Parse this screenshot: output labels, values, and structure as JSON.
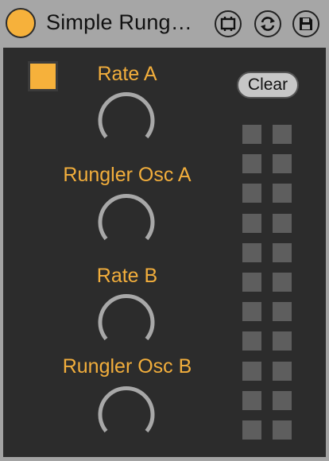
{
  "titlebar": {
    "title": "Simple Rung…",
    "buttons": [
      "freeze-icon",
      "hot-swap-icon",
      "save-icon"
    ]
  },
  "colors": {
    "accent": "#f6b13b",
    "panel": "#2c2c2c",
    "knob_arc": "#a8a8a8",
    "cell": "#5e5e5e"
  },
  "device": {
    "toggle_on": true,
    "clear_label": "Clear",
    "knobs": [
      {
        "label": "Rate A"
      },
      {
        "label": "Rungler Osc A"
      },
      {
        "label": "Rate B"
      },
      {
        "label": "Rungler Osc B"
      }
    ],
    "grid": {
      "columns": 2,
      "rows": 11
    }
  }
}
